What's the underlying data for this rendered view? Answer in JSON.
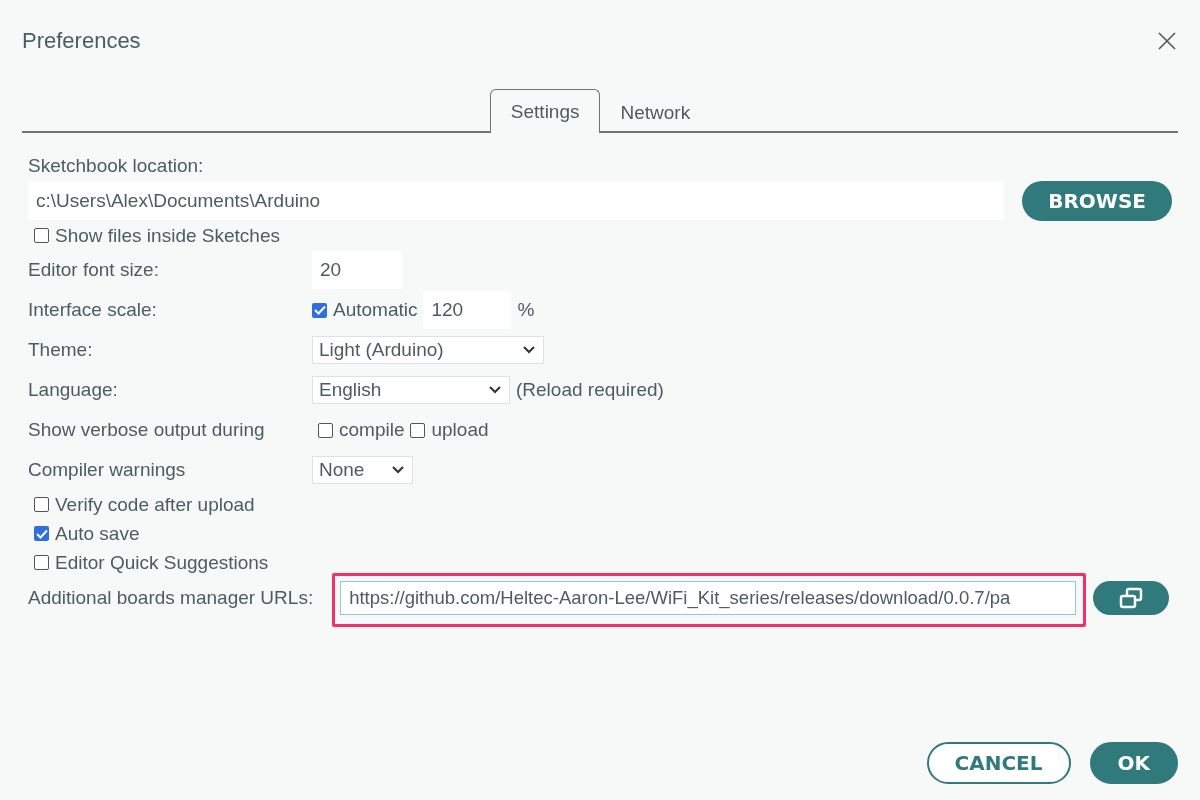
{
  "window": {
    "title": "Preferences"
  },
  "tabs": [
    {
      "label": "Settings",
      "selected": true
    },
    {
      "label": "Network",
      "selected": false
    }
  ],
  "sketchbook": {
    "label": "Sketchbook location:",
    "value": "c:\\Users\\Alex\\Documents\\Arduino",
    "browse": "BROWSE"
  },
  "show_files": {
    "label": "Show files inside Sketches",
    "checked": false
  },
  "editor_font_size": {
    "label": "Editor font size:",
    "value": "20"
  },
  "interface_scale": {
    "label": "Interface scale:",
    "automatic": {
      "label": "Automatic",
      "checked": true
    },
    "value": "120",
    "unit": "%"
  },
  "theme": {
    "label": "Theme:",
    "value": "Light (Arduino)"
  },
  "language": {
    "label": "Language:",
    "value": "English",
    "note": "(Reload required)"
  },
  "verbose": {
    "label": "Show verbose output during",
    "options": [
      {
        "label": "compile",
        "checked": false
      },
      {
        "label": "upload",
        "checked": false
      }
    ]
  },
  "compiler_warnings": {
    "label": "Compiler warnings",
    "value": "None"
  },
  "options": [
    {
      "label": "Verify code after upload",
      "checked": false
    },
    {
      "label": "Auto save",
      "checked": true
    },
    {
      "label": "Editor Quick Suggestions",
      "checked": false
    }
  ],
  "boards_urls": {
    "label": "Additional boards manager URLs:",
    "value": "https://github.com/Heltec-Aaron-Lee/WiFi_Kit_series/releases/download/0.0.7/pa",
    "highlighted": true
  },
  "buttons": [
    {
      "label": "CANCEL",
      "kind": "secondary"
    },
    {
      "label": "OK",
      "kind": "primary"
    }
  ]
}
